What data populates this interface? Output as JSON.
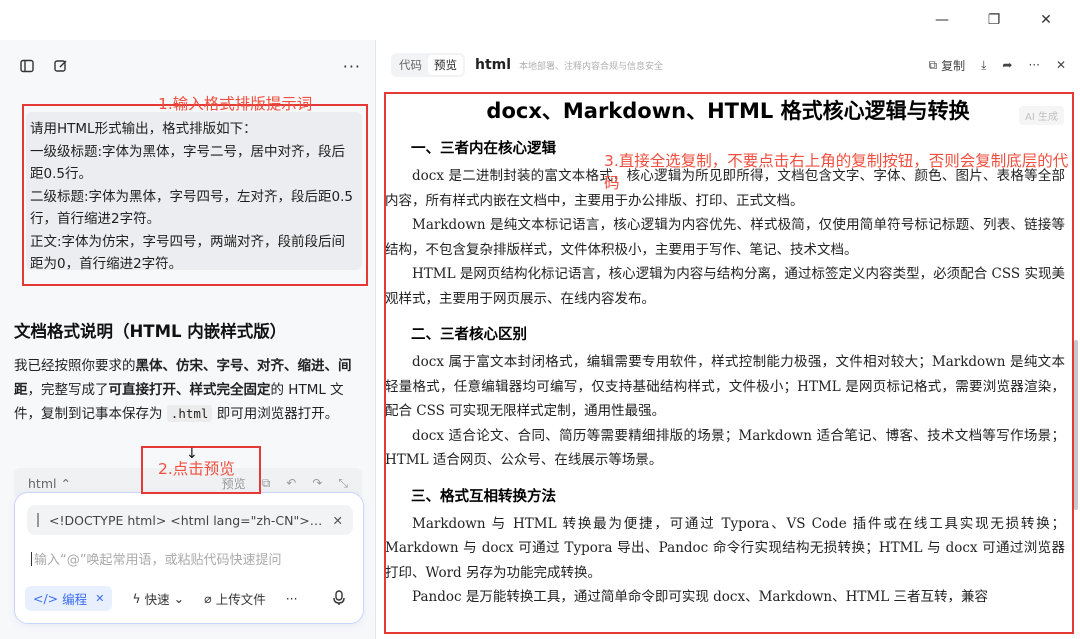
{
  "window": {
    "minimize": "—",
    "maximize": "❐",
    "close": "✕"
  },
  "left": {
    "more": "···",
    "user_prompt_lines": [
      "请用HTML形式输出，格式排版如下：",
      "一级级标题:字体为黑体，字号二号，居中对齐，段后距0.5行。",
      "二级标题:字体为黑体，字号四号，左对齐，段后距0.5行，首行缩进2字符。",
      "正文:字体为仿宋，字号四号，两端对齐，段前段后间距为0，首行缩进2字符。"
    ],
    "doc_title": "文档格式说明（HTML 内嵌样式版）",
    "desc": {
      "p1": "我已经按照你要求的",
      "b1": "黑体、仿宋、字号、对齐、缩进、间距",
      "p2": "，完整写成了",
      "b2": "可直接打开、样式完全固定",
      "p3": "的 HTML 文件，复制到记事本保存为 ",
      "code": ".html",
      "p4": " 即可用浏览器打开。"
    },
    "code_bar": {
      "lang": "html ⌃",
      "preview": "预览"
    },
    "composer": {
      "quote": "<!DOCTYPE html> <html lang=\"zh-CN\"> <he...",
      "placeholder": "输入“@”唤起常用语，或粘贴代码快速提问",
      "chip": "编程",
      "quick": "快速",
      "upload": "上传文件",
      "more": "···"
    }
  },
  "right": {
    "tab_code": "代码",
    "tab_preview": "预览",
    "title": "html",
    "subtitle": "本地部署、注释内容合规与信息安全",
    "copy": "复制",
    "ai_badge": "AI 生成",
    "doc": {
      "h1": "docx、Markdown、HTML 格式核心逻辑与转换",
      "s1": "一、三者内在核心逻辑",
      "s1p1": "docx 是二进制封装的富文本格式，核心逻辑为所见即所得，文档包含文字、字体、颜色、图片、表格等全部内容，所有样式内嵌在文档中，主要用于办公排版、打印、正式文档。",
      "s1p2": "Markdown 是纯文本标记语言，核心逻辑为内容优先、样式极简，仅使用简单符号标记标题、列表、链接等结构，不包含复杂排版样式，文件体积极小，主要用于写作、笔记、技术文档。",
      "s1p3": "HTML 是网页结构化标记语言，核心逻辑为内容与结构分离，通过标签定义内容类型，必须配合 CSS 实现美观样式，主要用于网页展示、在线内容发布。",
      "s2": "二、三者核心区别",
      "s2p1": "docx 属于富文本封闭格式，编辑需要专用软件，样式控制能力极强，文件相对较大；Markdown 是纯文本轻量格式，任意编辑器均可编写，仅支持基础结构样式，文件极小；HTML 是网页标记格式，需要浏览器渲染，配合 CSS 可实现无限样式定制，通用性最强。",
      "s2p2": "docx 适合论文、合同、简历等需要精细排版的场景；Markdown 适合笔记、博客、技术文档等写作场景；HTML 适合网页、公众号、在线展示等场景。",
      "s3": "三、格式互相转换方法",
      "s3p1": "Markdown 与 HTML 转换最为便捷，可通过 Typora、VS Code 插件或在线工具实现无损转换；Markdown 与 docx 可通过 Typora 导出、Pandoc 命令行实现结构无损转换；HTML 与 docx 可通过浏览器打印、Word 另存为功能完成转换。",
      "s3p2": "Pandoc 是万能转换工具，通过简单命令即可实现 docx、Markdown、HTML 三者互转，兼容"
    }
  },
  "annotations": {
    "a1": "1.输入格式排版提示词",
    "a2": "2.点击预览",
    "a3": "3.直接全选复制，不要点击右上角的复制按钮，否则会复制底层的代码",
    "arrow": "↓"
  },
  "colors": {
    "annotation": "#e53935",
    "accent": "#3b6cf5"
  }
}
